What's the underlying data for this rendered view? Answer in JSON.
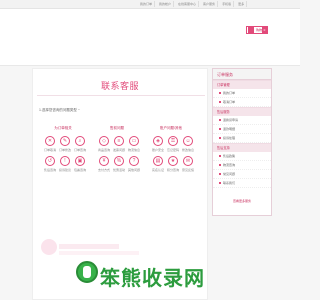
{
  "topbar": {
    "links": [
      "我的订单",
      "我的帐户",
      "在线客服中心",
      "客户服务",
      "手机版",
      "更多"
    ]
  },
  "header": {
    "cart_label": "购物车",
    "cart_count": "0"
  },
  "main": {
    "title": "联系客服",
    "intro": "1.选择您咨询的问题类型 ~",
    "columns": [
      {
        "title": "为订单相关",
        "items": [
          "订单取消",
          "订单修改",
          "订单查询",
          "售后咨询",
          "投诉建议",
          "包裹咨询"
        ]
      },
      {
        "title": "售前问题",
        "items": [
          "商品咨询",
          "发票问题",
          "物流信息",
          "支付方式",
          "优惠活动",
          "其他问题"
        ]
      },
      {
        "title": "账户问题/其他",
        "items": [
          "账户安全",
          "忘记密码",
          "修改信息",
          "实名认证",
          "积分查询",
          "意见反馈"
        ]
      }
    ],
    "watermark": "笨熊收录网"
  },
  "sidebar": {
    "head": "订单服务",
    "groups": [
      {
        "label": "订单管理",
        "items": [
          "我的订单",
          "取消订单"
        ]
      },
      {
        "label": "售后服务",
        "items": [
          "退换货申请",
          "退款明细",
          "投诉处理"
        ]
      },
      {
        "label": "售后支持",
        "items": [
          "售后政策",
          "物流查询",
          "常见问题",
          "联系我们"
        ]
      }
    ],
    "foot": "查看更多服务"
  }
}
